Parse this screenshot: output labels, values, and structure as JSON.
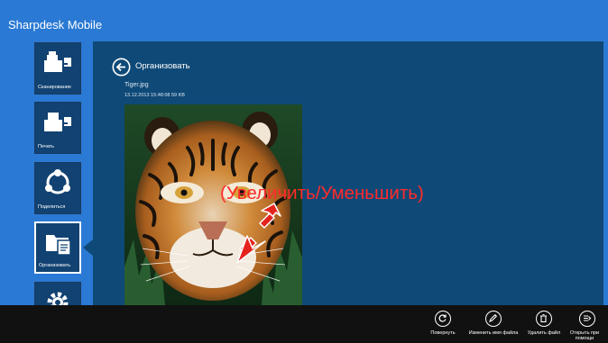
{
  "app": {
    "title": "Sharpdesk Mobile"
  },
  "sidebar": {
    "items": [
      {
        "label": "Сканирование",
        "icon": "scan-icon"
      },
      {
        "label": "Печать",
        "icon": "print-icon"
      },
      {
        "label": "Поделиться",
        "icon": "share-icon"
      },
      {
        "label": "Организовать",
        "icon": "organize-icon",
        "active": true
      },
      {
        "label": "",
        "icon": "settings-icon"
      }
    ]
  },
  "main": {
    "title": "Организовать",
    "file": {
      "name": "Tiger.jpg",
      "meta": "13.12.2013 15:48:08 59 KB"
    },
    "preview": {
      "alt": "tiger photo",
      "icon": "image-preview"
    }
  },
  "annotation": {
    "text": "(Увеличить/Уменьшить)",
    "color": "#ff2b2b"
  },
  "app_bar": {
    "commands": [
      {
        "label": "Повернуть",
        "icon": "rotate-icon"
      },
      {
        "label": "Изменить имя файла",
        "icon": "edit-icon"
      },
      {
        "label": "Удалить файл",
        "icon": "delete-icon"
      },
      {
        "label": "Открыть при помощи",
        "icon": "open-with-icon"
      }
    ]
  },
  "colors": {
    "background": "#2a79d4",
    "panel": "#0f4977",
    "tile": "#114272",
    "app_bar": "#111111"
  }
}
